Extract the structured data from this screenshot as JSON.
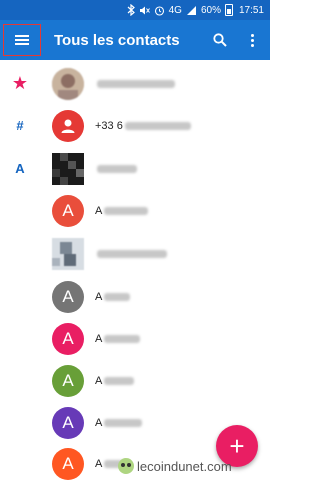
{
  "status_bar": {
    "network": "4G",
    "battery": "60%",
    "time": "17:51"
  },
  "app_bar": {
    "title": "Tous les contacts",
    "menu_icon": "hamburger-menu-icon",
    "search_icon": "search-icon",
    "more_icon": "more-vert-icon"
  },
  "index": {
    "favorites": "★",
    "hash": "#",
    "a": "A"
  },
  "contacts": [
    {
      "initial": "",
      "prefix": "",
      "avatar_color": "#b39c89",
      "avatar_type": "photo"
    },
    {
      "initial": "",
      "prefix": "+33 6",
      "avatar_color": "#e53935",
      "avatar_type": "person"
    },
    {
      "initial": "",
      "prefix": "",
      "avatar_color": "#2b2b2b",
      "avatar_type": "photo-dark"
    },
    {
      "initial": "A",
      "prefix": "A",
      "avatar_color": "#e94e3b"
    },
    {
      "initial": "",
      "prefix": "",
      "avatar_color": "#8b99a8",
      "avatar_type": "photo-blur"
    },
    {
      "initial": "A",
      "prefix": "A",
      "avatar_color": "#757575"
    },
    {
      "initial": "A",
      "prefix": "A",
      "avatar_color": "#e91e63"
    },
    {
      "initial": "A",
      "prefix": "A",
      "avatar_color": "#689f38"
    },
    {
      "initial": "A",
      "prefix": "A",
      "avatar_color": "#673ab7"
    },
    {
      "initial": "A",
      "prefix": "A",
      "avatar_color": "#ff5722"
    }
  ],
  "fab": {
    "label": "+",
    "icon": "add-icon",
    "color": "#e91e63"
  },
  "watermark": {
    "text": "lecoindunet.com"
  },
  "colors": {
    "status_bar": "#1565c0",
    "app_bar": "#1976d2",
    "accent": "#e91e63",
    "index_letter": "#1565c0"
  }
}
